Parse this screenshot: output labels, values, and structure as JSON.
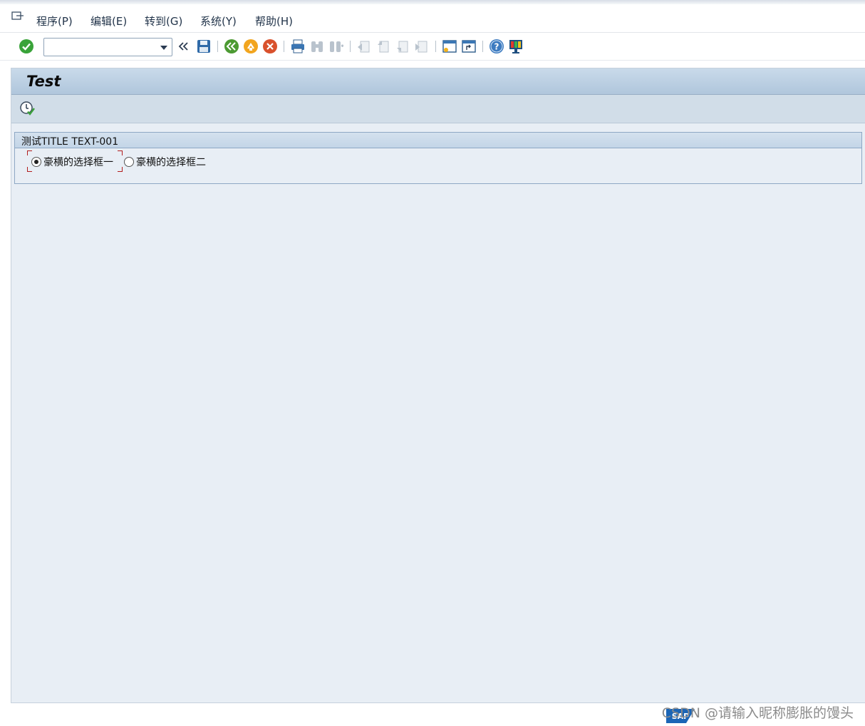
{
  "menubar": {
    "items": [
      "程序(P)",
      "编辑(E)",
      "转到(G)",
      "系统(Y)",
      "帮助(H)"
    ]
  },
  "toolbar": {
    "command_field_value": "",
    "icons": [
      "enter-icon",
      "back-history-icon",
      "save-icon",
      "back-icon",
      "exit-icon",
      "cancel-icon",
      "print-icon",
      "find-icon",
      "find-next-icon",
      "first-page-icon",
      "previous-page-icon",
      "next-page-icon",
      "last-page-icon",
      "create-session-icon",
      "shortcut-icon",
      "help-icon",
      "customize-layout-icon"
    ]
  },
  "screen": {
    "title": "Test"
  },
  "frame": {
    "title": "测试TITLE TEXT-001",
    "radio_options": [
      {
        "label": "豪横的选择框一",
        "checked": true
      },
      {
        "label": "豪横的选择框二",
        "checked": false
      }
    ]
  },
  "watermark": {
    "text": "CSDN @请输入昵称膨胀的馒头",
    "logo_text": "SAP"
  },
  "colors": {
    "title_bar": "#b0c6dc",
    "screen_bg": "#e8eef5",
    "focus_corner": "#b21d1d"
  }
}
